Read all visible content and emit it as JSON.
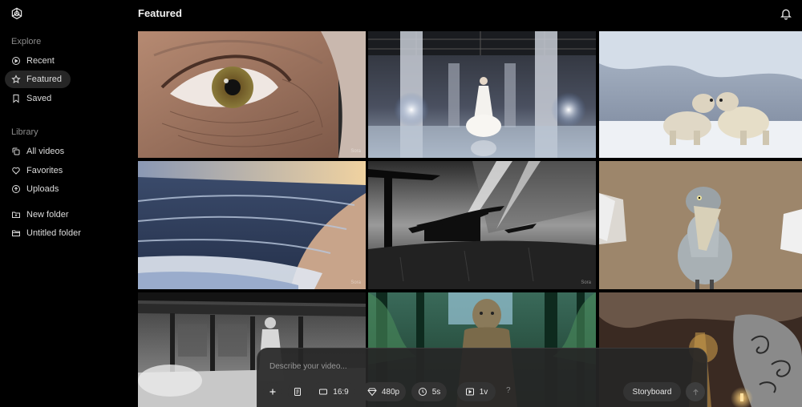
{
  "sidebar": {
    "explore_label": "Explore",
    "explore_items": [
      {
        "label": "Recent",
        "icon": "play-circle-icon"
      },
      {
        "label": "Featured",
        "icon": "star-icon",
        "active": true
      },
      {
        "label": "Saved",
        "icon": "bookmark-icon"
      }
    ],
    "library_label": "Library",
    "library_items": [
      {
        "label": "All videos",
        "icon": "stacked-squares-icon"
      },
      {
        "label": "Favorites",
        "icon": "heart-icon"
      },
      {
        "label": "Uploads",
        "icon": "upload-circle-icon"
      }
    ],
    "folders": [
      {
        "label": "New folder",
        "icon": "folder-plus-icon"
      },
      {
        "label": "Untitled folder",
        "icon": "folder-icon"
      }
    ]
  },
  "header": {
    "title": "Featured",
    "icon": "bell-icon"
  },
  "grid": {
    "tiles": [
      {
        "subject": "eye-closeup",
        "watermark": "Sora"
      },
      {
        "subject": "runway-figure",
        "watermark": ""
      },
      {
        "subject": "polar-bears",
        "watermark": ""
      },
      {
        "subject": "ocean-waves",
        "watermark": "Sora"
      },
      {
        "subject": "pagoda-silhouette",
        "watermark": "Sora"
      },
      {
        "subject": "shoebill-bird",
        "watermark": ""
      },
      {
        "subject": "temple-courtyard",
        "watermark": ""
      },
      {
        "subject": "jungle-statue",
        "watermark": ""
      },
      {
        "subject": "cave-lantern",
        "watermark": ""
      }
    ]
  },
  "composer": {
    "placeholder": "Describe your video...",
    "aspect_ratio": "16:9",
    "resolution": "480p",
    "duration": "5s",
    "variations": "1v",
    "help": "?",
    "storyboard": "Storyboard"
  },
  "colors": {
    "background": "#000000",
    "active_nav": "#262626",
    "composer": "#262626"
  }
}
